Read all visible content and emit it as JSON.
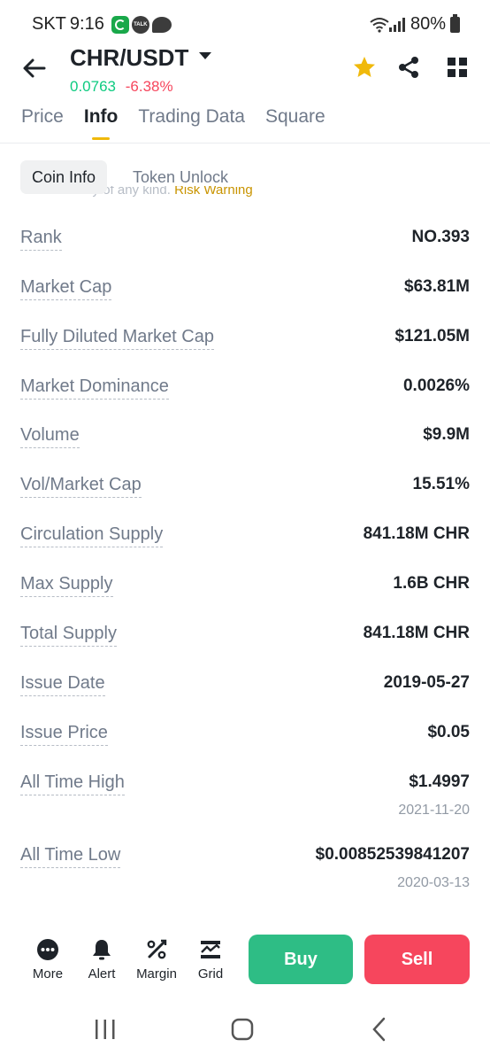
{
  "status_bar": {
    "carrier": "SKT",
    "time": "9:16",
    "talk_icon_text": "TALK",
    "battery": "80%"
  },
  "header": {
    "pair": "CHR/USDT",
    "price": "0.0763",
    "change": "-6.38%"
  },
  "tabs": [
    {
      "label": "Price"
    },
    {
      "label": "Info"
    },
    {
      "label": "Trading Data"
    },
    {
      "label": "Square"
    }
  ],
  "subtabs": {
    "coin_info": "Coin Info",
    "token_unlock": "Token Unlock"
  },
  "warning": {
    "text": "or warranty of any kind.",
    "link": "Risk Warning"
  },
  "rows": [
    {
      "label": "Rank",
      "value": "NO.393"
    },
    {
      "label": "Market Cap",
      "value": "$63.81M"
    },
    {
      "label": "Fully Diluted Market Cap",
      "value": "$121.05M"
    },
    {
      "label": "Market Dominance",
      "value": "0.0026%"
    },
    {
      "label": "Volume",
      "value": "$9.9M"
    },
    {
      "label": "Vol/Market Cap",
      "value": "15.51%"
    },
    {
      "label": "Circulation Supply",
      "value": "841.18M CHR"
    },
    {
      "label": "Max Supply",
      "value": "1.6B CHR"
    },
    {
      "label": "Total Supply",
      "value": "841.18M CHR"
    },
    {
      "label": "Issue Date",
      "value": "2019-05-27"
    },
    {
      "label": "Issue Price",
      "value": "$0.05"
    },
    {
      "label": "All Time High",
      "value": "$1.4997",
      "sub": "2021-11-20"
    },
    {
      "label": "All Time Low",
      "value": "$0.00852539841207",
      "sub": "2020-03-13"
    }
  ],
  "bottom_bar": {
    "more": "More",
    "alert": "Alert",
    "margin": "Margin",
    "grid": "Grid",
    "buy": "Buy",
    "sell": "Sell"
  },
  "colors": {
    "accent": "#f0b90b",
    "up": "#0ecb81",
    "down": "#f6465d",
    "buy": "#2ebd85",
    "sell": "#f6465d"
  }
}
